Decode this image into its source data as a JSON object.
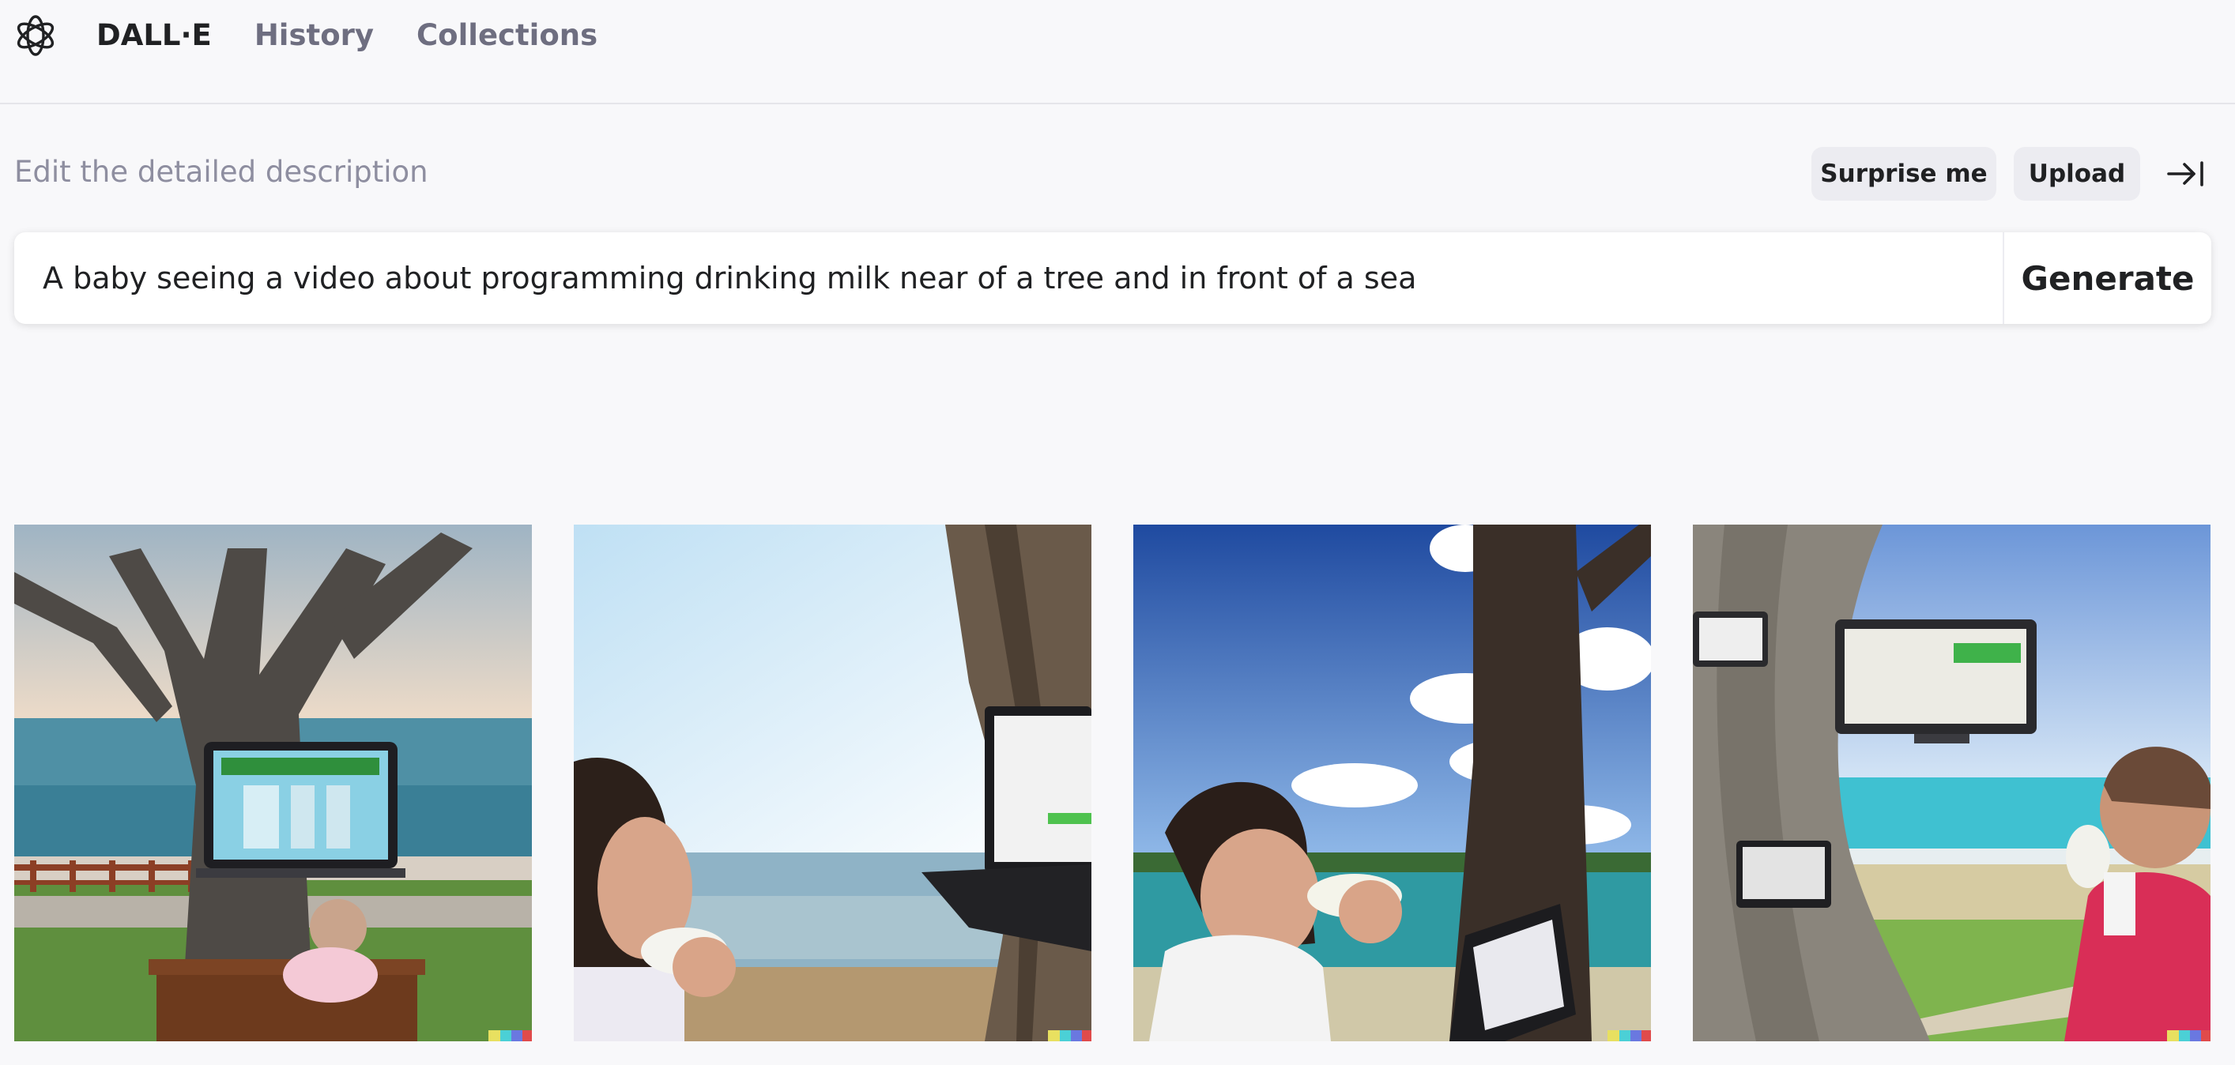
{
  "nav": {
    "brand": "DALL·E",
    "items": [
      "History",
      "Collections"
    ]
  },
  "editor": {
    "description_label": "Edit the detailed description",
    "surprise_label": "Surprise me",
    "upload_label": "Upload",
    "prompt_value": "A baby seeing a video about programming drinking milk near of a tree and in front of a sea",
    "generate_label": "Generate"
  },
  "icons": {
    "logo": "openai-logo-icon",
    "collapse": "arrow-to-right-icon"
  },
  "colors": {
    "background": "#f8f8fa",
    "pill": "#ececf1",
    "text": "#202123",
    "muted": "#6e6e80"
  },
  "results": {
    "count": 4
  }
}
